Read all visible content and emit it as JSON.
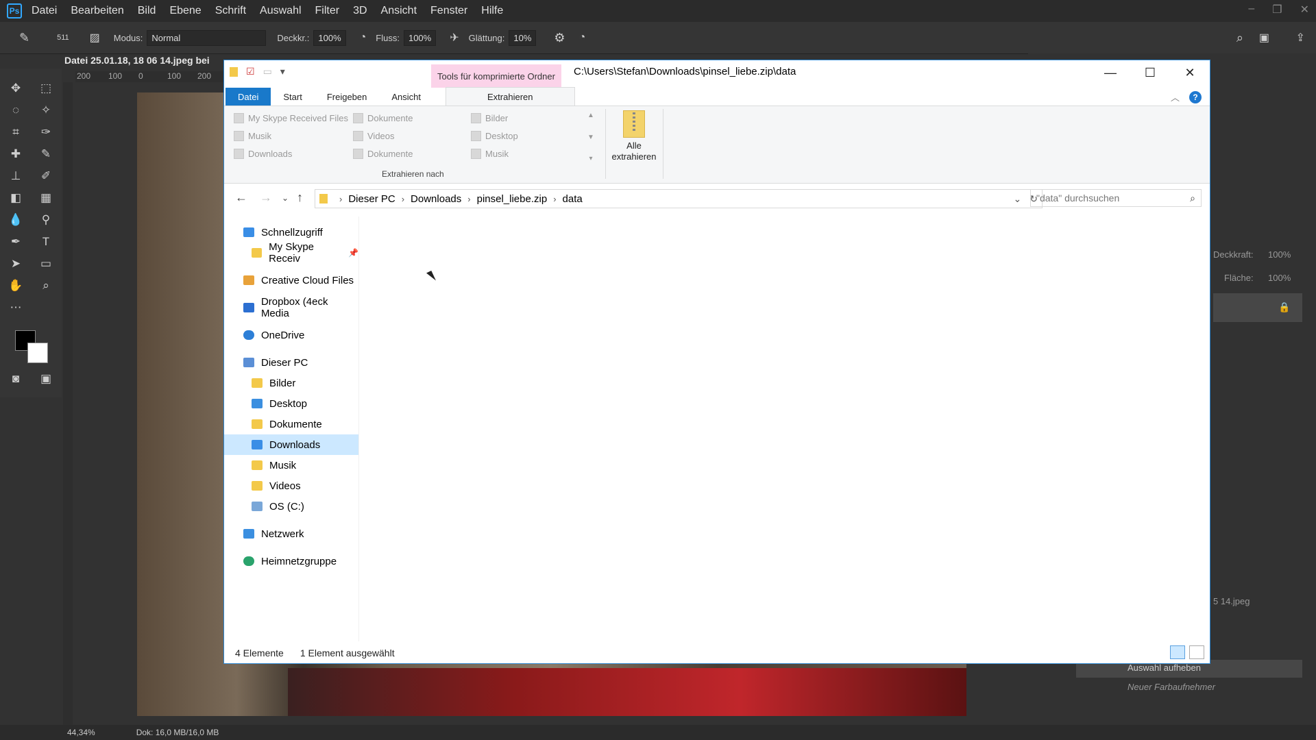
{
  "photoshop": {
    "logo": "Ps",
    "menu": [
      "Datei",
      "Bearbeiten",
      "Bild",
      "Ebene",
      "Schrift",
      "Auswahl",
      "Filter",
      "3D",
      "Ansicht",
      "Fenster",
      "Hilfe"
    ],
    "options": {
      "brush_size": "511",
      "mode_label": "Modus:",
      "mode_value": "Normal",
      "opacity_label": "Deckkr.:",
      "opacity_value": "100%",
      "flow_label": "Fluss:",
      "flow_value": "100%",
      "smoothing_label": "Glättung:",
      "smoothing_value": "10%"
    },
    "doc_tab": "Datei 25.01.18, 18 06 14.jpeg bei",
    "ruler_ticks": [
      "200",
      "100",
      "0",
      "100",
      "200"
    ],
    "status": {
      "zoom": "44,34%",
      "doc": "Dok: 16,0 MB/16,0 MB"
    },
    "right_panel": {
      "opacity_label": "Deckkraft:",
      "opacity_value": "100%",
      "fill_label": "Fläche:",
      "fill_value": "100%",
      "history_file": "5 14.jpeg",
      "history_item_1": "Auswahl aufheben",
      "history_item_2": "Neuer Farbaufnehmer"
    }
  },
  "explorer": {
    "context_tab": "Tools für komprimierte Ordner",
    "title_path": "C:\\Users\\Stefan\\Downloads\\pinsel_liebe.zip\\data",
    "tabs": {
      "file": "Datei",
      "start": "Start",
      "share": "Freigeben",
      "view": "Ansicht",
      "extract": "Extrahieren"
    },
    "destinations": [
      [
        "My Skype Received Files",
        "Dokumente",
        "Bilder"
      ],
      [
        "Musik",
        "Videos",
        "Desktop"
      ],
      [
        "Downloads",
        "Dokumente",
        "Musik"
      ]
    ],
    "group_label": "Extrahieren nach",
    "extract_all": "Alle extrahieren",
    "breadcrumb": [
      "Dieser PC",
      "Downloads",
      "pinsel_liebe.zip",
      "data"
    ],
    "search_placeholder": "\"data\" durchsuchen",
    "nav": [
      {
        "label": "Schnellzugriff",
        "indent": 0,
        "color": "#3a8ee6"
      },
      {
        "label": "My Skype Receiv",
        "indent": 1,
        "color": "#f3c94a"
      },
      {
        "label": "Creative Cloud Files",
        "indent": 0,
        "color": "#e8a23a"
      },
      {
        "label": "Dropbox (4eck Media",
        "indent": 0,
        "color": "#2c6fd1"
      },
      {
        "label": "OneDrive",
        "indent": 0,
        "color": "#2d7fd7"
      },
      {
        "label": "Dieser PC",
        "indent": 0,
        "color": "#5b8fd6"
      },
      {
        "label": "Bilder",
        "indent": 1,
        "color": "#f3c94a"
      },
      {
        "label": "Desktop",
        "indent": 1,
        "color": "#3b8fe0"
      },
      {
        "label": "Dokumente",
        "indent": 1,
        "color": "#f3c94a"
      },
      {
        "label": "Downloads",
        "indent": 1,
        "color": "#3a8ee6"
      },
      {
        "label": "Musik",
        "indent": 1,
        "color": "#f3c94a"
      },
      {
        "label": "Videos",
        "indent": 1,
        "color": "#f3c94a"
      },
      {
        "label": "OS (C:)",
        "indent": 1,
        "color": "#7aa7d8"
      },
      {
        "label": "Netzwerk",
        "indent": 0,
        "color": "#3b8fe0"
      },
      {
        "label": "Heimnetzgruppe",
        "indent": 0,
        "color": "#2aa36c"
      }
    ],
    "selected_nav": "Downloads",
    "status": {
      "count": "4 Elemente",
      "selected": "1 Element ausgewählt"
    }
  }
}
